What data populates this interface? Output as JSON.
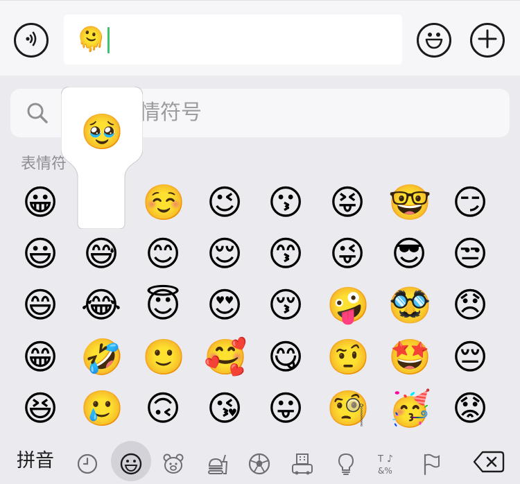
{
  "input": {
    "content": "🫠"
  },
  "icons": {
    "voice": "voice-icon",
    "emoji": "emoji-smile-icon",
    "plus": "plus-icon",
    "search": "search-icon",
    "delete": "delete-backspace-icon"
  },
  "search": {
    "placeholder_visible": "情符号"
  },
  "section": {
    "label_visible": "表情符"
  },
  "preview": {
    "emoji": "🥹"
  },
  "emoji_grid": {
    "rows": [
      [
        "😀",
        "",
        "☺️",
        "😉",
        "😗",
        "😝",
        "🤓",
        "😏",
        ""
      ],
      [
        "😃",
        "😅",
        "😊",
        "😌",
        "😙",
        "😜",
        "😎",
        "😒",
        ""
      ],
      [
        "😄",
        "😂",
        "😇",
        "😍",
        "😚",
        "🤪",
        "🥸",
        "😞",
        ""
      ],
      [
        "😁",
        "🤣",
        "🙂",
        "🥰",
        "😋",
        "🤨",
        "🤩",
        "😔",
        ""
      ],
      [
        "😆",
        "🥲",
        "🙃",
        "😘",
        "😛",
        "🧐",
        "🥳",
        "😟",
        ""
      ]
    ]
  },
  "bottom_bar": {
    "input_method": "拼音",
    "categories": [
      {
        "name": "recent-clock-icon",
        "glyph": "🕘"
      },
      {
        "name": "smileys-icon",
        "glyph": "☺",
        "selected": true
      },
      {
        "name": "animals-icon",
        "glyph": "🐻"
      },
      {
        "name": "food-icon",
        "glyph": "🍔"
      },
      {
        "name": "activity-icon",
        "glyph": "⚽"
      },
      {
        "name": "travel-icon",
        "glyph": "🏢"
      },
      {
        "name": "objects-icon",
        "glyph": "💡"
      },
      {
        "name": "symbols-icon",
        "glyph": "♫"
      },
      {
        "name": "flags-icon",
        "glyph": "⚑"
      }
    ]
  }
}
